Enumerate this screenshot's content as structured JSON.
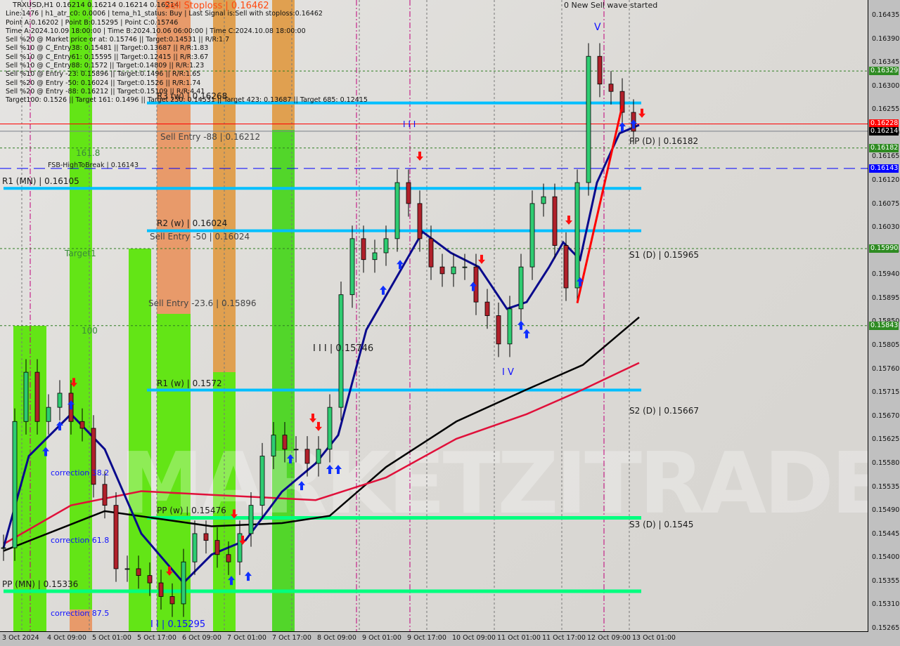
{
  "header": {
    "symbol_line": "TRXUSD,H1  0.16214 0.16214 0.16214 0.16214",
    "info_lines": [
      "Line:1476 | h1_atr_c0: 0.0006 | tema_h1_status: Buy | Last Signal is:Sell with stoploss:0.16462",
      "Point A:0.16202 | Point B:0.15295 | Point C:0.15746",
      "Time A:2024.10.09 18:00:00 | Time B:2024.10.06 06:00:00 | Time C:2024.10.08 18:00:00",
      "Sell %20 @ Market price or at: 0.15746 || Target:0.14531 || R/R:1.7",
      "Sell %10 @ C_Entry38: 0.15481 || Target:0.13687 || R/R:1.83",
      "Sell %10 @ C_Entry61: 0.15595 || Target:0.12415 || R/R:3.67",
      "Sell %10 @ C_Entry88: 0.1572 || Target:0.14809 || R/R:1.23",
      "Sell %10 @ Entry -23: 0.15896 || Target:0.1496 || R/R:1.65",
      "Sell %20 @ Entry -50: 0.16024 || Target:0.1526 || R/R:1.74",
      "Sell %20 @ Entry -88: 0.16212 || Target:0.15109 || R/R:4.41",
      "Target100: 0.1526 || Target 161: 0.1496 || Target 250: 0.14531 || Target 423: 0.13687 || Target 685: 0.12415"
    ],
    "stoploss_label": "Sell Stoploss | 0.16462"
  },
  "watermark": "MARKETZITRADE",
  "annotations": {
    "new_wave": "0 New Sell wave started",
    "wave_v": "V",
    "wave_iii_top": "I I I",
    "wave_iii": "I I I | 0.15746",
    "wave_iv": "I V",
    "wave_ii": "I I | 0.15295",
    "r3_w": "R3 (w) | 0.16268",
    "sell_entry_88": "Sell Entry -88 | 0.16212",
    "fib_161": "161.8",
    "fsb": "FSB-HighToBreak | 0.16143",
    "r1_mn": "R1 (MN) | 0.16105",
    "r2_w": "R2 (w) | 0.16024",
    "sell_entry_50": "Sell Entry -50 | 0.16024",
    "target1": "Target1",
    "sell_entry_236": "Sell Entry -23.6 | 0.15896",
    "fib_100": "100",
    "r1_w": "R1 (w) | 0.1572",
    "pp_w": "PP (w) | 0.15476",
    "pp_mn": "PP (MN) | 0.15336",
    "corr_382": "correction 38.2",
    "corr_618": "correction 61.8",
    "corr_875": "correction 87.5",
    "pp_d": "PP (D) | 0.16182",
    "s1_d": "S1 (D) | 0.15965",
    "s2_d": "S2 (D) | 0.15667",
    "s3_d": "S3 (D) | 0.1545"
  },
  "price_tags": [
    {
      "value": "0.16329",
      "color": "#2e8b22"
    },
    {
      "value": "0.16228",
      "color": "#ff0000"
    },
    {
      "value": "0.16214",
      "color": "#000000"
    },
    {
      "value": "0.16182",
      "color": "#2e8b22"
    },
    {
      "value": "0.16143",
      "color": "#0000ff"
    },
    {
      "value": "0.15990",
      "color": "#2e8b22"
    },
    {
      "value": "0.15843",
      "color": "#2e8b22"
    }
  ],
  "chart_data": {
    "type": "candlestick",
    "symbol": "TRXUSD",
    "timeframe": "H1",
    "start": "2024-10-03 18:00",
    "interval_hours": 4,
    "closes": [
      0.15419,
      0.1566,
      0.15754,
      0.1566,
      0.15687,
      0.15714,
      0.1566,
      0.15647,
      0.1554,
      0.155,
      0.15379,
      0.15379,
      0.15366,
      0.15352,
      0.15326,
      0.15312,
      0.15392,
      0.15446,
      0.15433,
      0.15406,
      0.15392,
      0.15446,
      0.155,
      0.15594,
      0.15634,
      0.15607,
      0.15607,
      0.1558,
      0.15607,
      0.15687,
      0.15902,
      0.16009,
      0.15969,
      0.15982,
      0.16009,
      0.16116,
      0.16076,
      0.16009,
      0.15955,
      0.15942,
      0.15955,
      0.15955,
      0.15888,
      0.15862,
      0.15808,
      0.15875,
      0.15955,
      0.16076,
      0.16089,
      0.15996,
      0.15915,
      0.16116,
      0.16357,
      0.16304,
      0.1629,
      0.1625,
      0.16214
    ],
    "ylim": [
      0.1525,
      0.1647
    ],
    "y_ticks": [
      "0.16435",
      "0.16390",
      "0.16345",
      "0.16300",
      "0.16255",
      "0.16210",
      "0.16165",
      "0.16120",
      "0.16075",
      "0.16030",
      "0.15985",
      "0.15940",
      "0.15895",
      "0.15850",
      "0.15805",
      "0.15760",
      "0.15715",
      "0.15670",
      "0.15625",
      "0.15580",
      "0.15535",
      "0.15490",
      "0.15445",
      "0.15400",
      "0.15355",
      "0.15310",
      "0.15265"
    ],
    "x_ticks": [
      "3 Oct 2024",
      "4 Oct 09:00",
      "5 Oct 01:00",
      "5 Oct 17:00",
      "6 Oct 09:00",
      "7 Oct 01:00",
      "7 Oct 17:00",
      "8 Oct 09:00",
      "9 Oct 01:00",
      "9 Oct 17:00",
      "10 Oct 09:00",
      "11 Oct 01:00",
      "11 Oct 17:00",
      "12 Oct 09:00",
      "13 Oct 01:00"
    ],
    "ma_lines": [
      {
        "color": "#000000",
        "points": [
          [
            "2024-10-03 18:00",
            0.15413
          ],
          [
            "2024-10-05 06:00",
            0.15489
          ],
          [
            "2024-10-06 20:00",
            0.1546
          ],
          [
            "2024-10-07 21:00",
            0.15466
          ],
          [
            "2024-10-08 14:00",
            0.1548
          ],
          [
            "2024-10-09 10:00",
            0.15573
          ],
          [
            "2024-10-10 11:00",
            0.1566
          ],
          [
            "2024-10-11 12:00",
            0.15721
          ],
          [
            "2024-10-12 08:00",
            0.15768
          ],
          [
            "2024-10-13 04:00",
            0.15859
          ]
        ]
      },
      {
        "color": "#e0103a",
        "points": [
          [
            "2024-10-03 18:00",
            0.15426
          ],
          [
            "2024-10-04 18:00",
            0.155
          ],
          [
            "2024-10-05 19:00",
            0.15527
          ],
          [
            "2024-10-06 20:00",
            0.1552
          ],
          [
            "2024-10-08 09:00",
            0.1551
          ],
          [
            "2024-10-09 10:00",
            0.15553
          ],
          [
            "2024-10-10 11:00",
            0.15627
          ],
          [
            "2024-10-11 12:00",
            0.15674
          ],
          [
            "2024-10-12 08:00",
            0.15721
          ],
          [
            "2024-10-13 04:00",
            0.15772
          ]
        ]
      },
      {
        "color": "#0a0a8c",
        "points": [
          [
            "2024-10-03 18:00",
            0.15419
          ],
          [
            "2024-10-04 03:00",
            0.15594
          ],
          [
            "2024-10-04 18:00",
            0.15674
          ],
          [
            "2024-10-05 06:00",
            0.15607
          ],
          [
            "2024-10-05 19:00",
            0.15446
          ],
          [
            "2024-10-06 10:00",
            0.15352
          ],
          [
            "2024-10-06 20:00",
            0.15406
          ],
          [
            "2024-10-07 08:00",
            0.15433
          ],
          [
            "2024-10-07 21:00",
            0.15526
          ],
          [
            "2024-10-08 09:00",
            0.1558
          ],
          [
            "2024-10-08 17:00",
            0.15634
          ],
          [
            "2024-10-09 03:00",
            0.15835
          ],
          [
            "2024-10-09 13:00",
            0.15928
          ],
          [
            "2024-10-09 23:00",
            0.16022
          ],
          [
            "2024-10-10 09:00",
            0.15982
          ],
          [
            "2024-10-10 19:00",
            0.15955
          ],
          [
            "2024-10-11 05:00",
            0.15875
          ],
          [
            "2024-10-11 12:00",
            0.15888
          ],
          [
            "2024-10-11 20:00",
            0.15955
          ],
          [
            "2024-10-12 01:00",
            0.16002
          ],
          [
            "2024-10-12 07:00",
            0.15969
          ],
          [
            "2024-10-12 13:00",
            0.16116
          ],
          [
            "2024-10-12 21:00",
            0.1621
          ],
          [
            "2024-10-13 04:00",
            0.16226
          ]
        ]
      }
    ],
    "trendline": {
      "color": "#ff0000",
      "points": [
        [
          "2024-10-12 06:00",
          0.15886
        ],
        [
          "2024-10-12 22:00",
          0.16263
        ]
      ]
    },
    "levels": [
      {
        "price": 0.16268,
        "style": "cyan",
        "from": "2024-10-05 21:00"
      },
      {
        "price": 0.16105,
        "style": "cyan",
        "from": "2024-10-03 18:00"
      },
      {
        "price": 0.16024,
        "style": "cyan",
        "from": "2024-10-05 21:00"
      },
      {
        "price": 0.1572,
        "style": "cyan",
        "from": "2024-10-05 21:00"
      },
      {
        "price": 0.15476,
        "style": "green",
        "from": "2024-10-05 21:00"
      },
      {
        "price": 0.15336,
        "style": "green",
        "from": "2024-10-03 18:00"
      },
      {
        "price": 0.16143,
        "style": "blue-dash"
      },
      {
        "price": 0.16329,
        "style": "green-dot"
      },
      {
        "price": 0.16182,
        "style": "green-dot"
      },
      {
        "price": 0.1599,
        "style": "green-dot"
      },
      {
        "price": 0.15843,
        "style": "green-dot"
      },
      {
        "price": 0.16228,
        "style": "red"
      },
      {
        "price": 0.16214,
        "style": "grey"
      }
    ],
    "signals_up": [
      [
        "2024-10-04 09:00",
        0.15614
      ],
      [
        "2024-10-04 14:00",
        0.15663
      ],
      [
        "2024-10-04 18:00",
        0.15703
      ],
      [
        "2024-10-07 03:00",
        0.15368
      ],
      [
        "2024-10-07 09:00",
        0.15376
      ],
      [
        "2024-10-08 00:00",
        0.156
      ],
      [
        "2024-10-08 04:00",
        0.15549
      ],
      [
        "2024-10-08 14:00",
        0.1558
      ],
      [
        "2024-10-08 17:00",
        0.1558
      ],
      [
        "2024-10-09 09:00",
        0.15922
      ],
      [
        "2024-10-09 15:00",
        0.15971
      ],
      [
        "2024-10-10 17:00",
        0.15929
      ],
      [
        "2024-10-11 10:00",
        0.15855
      ],
      [
        "2024-10-11 12:00",
        0.15839
      ],
      [
        "2024-10-12 07:00",
        0.15938
      ],
      [
        "2024-10-12 22:00",
        0.16234
      ],
      [
        "2024-10-13 02:00",
        0.16239
      ]
    ],
    "signals_down": [
      [
        "2024-10-04 19:00",
        0.15723
      ],
      [
        "2024-10-06 05:00",
        0.15363
      ],
      [
        "2024-10-07 04:00",
        0.15472
      ],
      [
        "2024-10-07 07:00",
        0.15422
      ],
      [
        "2024-10-08 08:00",
        0.15655
      ],
      [
        "2024-10-08 10:00",
        0.15639
      ],
      [
        "2024-10-09 22:00",
        0.16155
      ],
      [
        "2024-10-10 20:00",
        0.15958
      ],
      [
        "2024-10-12 03:00",
        0.16033
      ],
      [
        "2024-10-13 05:00",
        0.16237
      ]
    ]
  }
}
